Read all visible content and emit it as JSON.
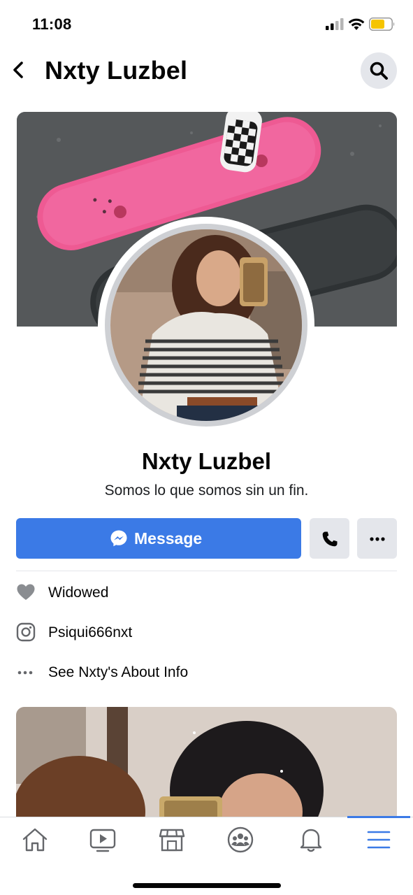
{
  "status_bar": {
    "time": "11:08",
    "signal_icon": "cellular-signal-icon",
    "wifi_icon": "wifi-icon",
    "battery_icon": "battery-icon",
    "battery_color": "#f5c400"
  },
  "header": {
    "title": "Nxty Luzbel",
    "back_icon": "chevron-left-icon",
    "search_icon": "search-icon"
  },
  "profile": {
    "name": "Nxty Luzbel",
    "bio": "Somos lo que somos sin un fin."
  },
  "actions": {
    "message_label": "Message",
    "message_icon": "messenger-icon",
    "call_icon": "phone-icon",
    "more_icon": "more-dots-icon",
    "accent_color": "#3b7ae6"
  },
  "info": {
    "relationship": "Widowed",
    "instagram": "Psiqui666nxt",
    "about_link": "See Nxty's About Info"
  },
  "tab_bar": {
    "tabs": [
      "home-icon",
      "watch-icon",
      "marketplace-icon",
      "groups-icon",
      "notifications-icon",
      "menu-icon"
    ],
    "active_tab": "menu-icon"
  }
}
